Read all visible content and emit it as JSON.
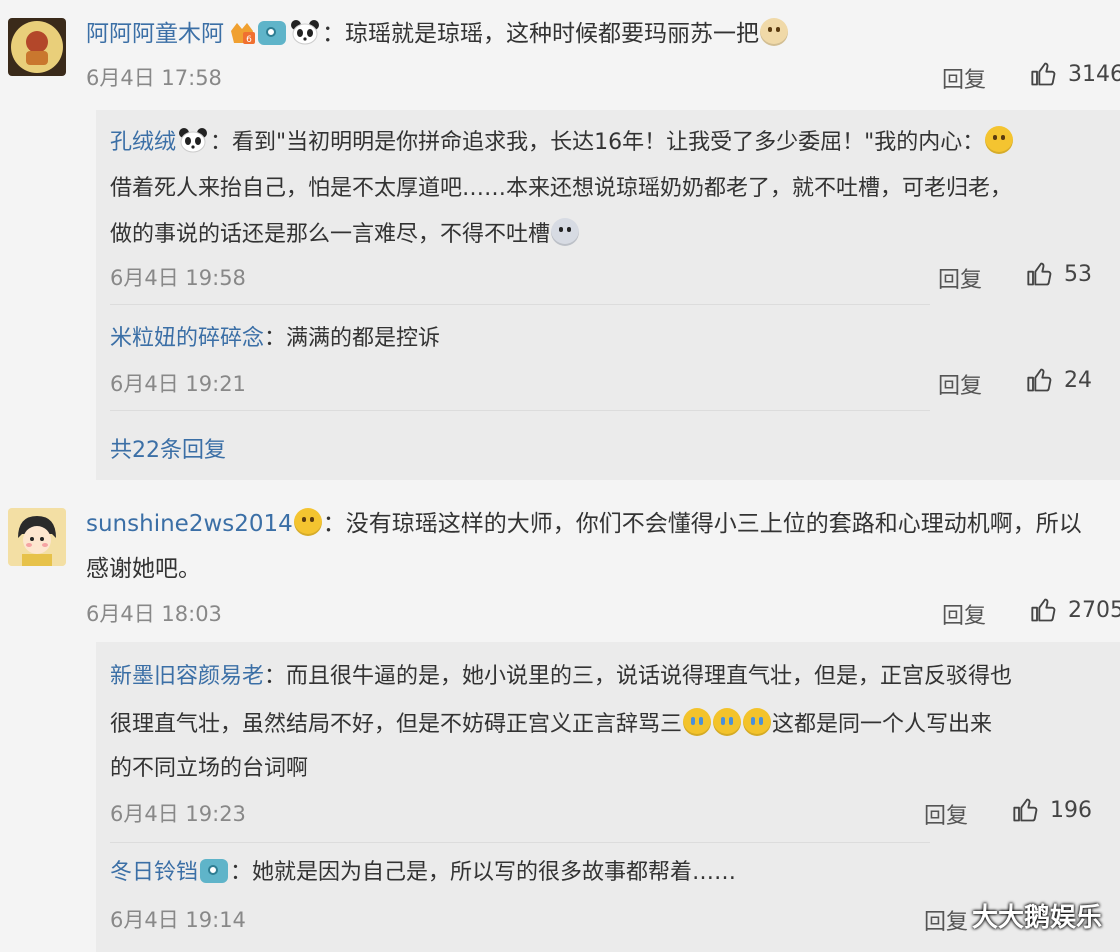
{
  "comments": [
    {
      "user": "阿阿阿童木阿",
      "text": "琼瑶就是琼瑶，这种时候都要玛丽苏一把",
      "time": "6月4日 17:58",
      "reply_label": "回复",
      "likes": "3146",
      "replies": [
        {
          "user": "孔绒绒",
          "lines": [
            "看到\"当初明明是你拼命追求我，长达16年！让我受了多少委屈！\"我的内心：",
            "借着死人来抬自己，怕是不太厚道吧……本来还想说琼瑶奶奶都老了，就不吐槽，可老归老，",
            "做的事说的话还是那么一言难尽，不得不吐槽"
          ],
          "time": "6月4日 19:58",
          "reply_label": "回复",
          "likes": "53"
        },
        {
          "user": "米粒妞的碎碎念",
          "lines": [
            "满满的都是控诉"
          ],
          "time": "6月4日 19:21",
          "reply_label": "回复",
          "likes": "24"
        }
      ],
      "more_replies": "共22条回复"
    },
    {
      "user": "sunshine2ws2014",
      "text_lines": [
        "没有琼瑶这样的大师，你们不会懂得小三上位的套路和心理动机啊，所以",
        "感谢她吧。"
      ],
      "time": "6月4日 18:03",
      "reply_label": "回复",
      "likes": "2705",
      "replies": [
        {
          "user": "新墨旧容颜易老",
          "lines": [
            "而且很牛逼的是，她小说里的三，说话说得理直气壮，但是，正宫反驳得也",
            "很理直气壮，虽然结局不好，但是不妨碍正宫义正言辞骂三",
            "这都是同一个人写出来",
            "的不同立场的台词啊"
          ],
          "time": "6月4日 19:23",
          "reply_label": "回复",
          "likes": "196"
        },
        {
          "user": "冬日铃铛",
          "lines": [
            "她就是因为自己是，所以写的很多故事都帮着……"
          ],
          "time": "6月4日 19:14",
          "reply_label": "回复"
        }
      ]
    }
  ],
  "watermark": "大大鹅娱乐"
}
